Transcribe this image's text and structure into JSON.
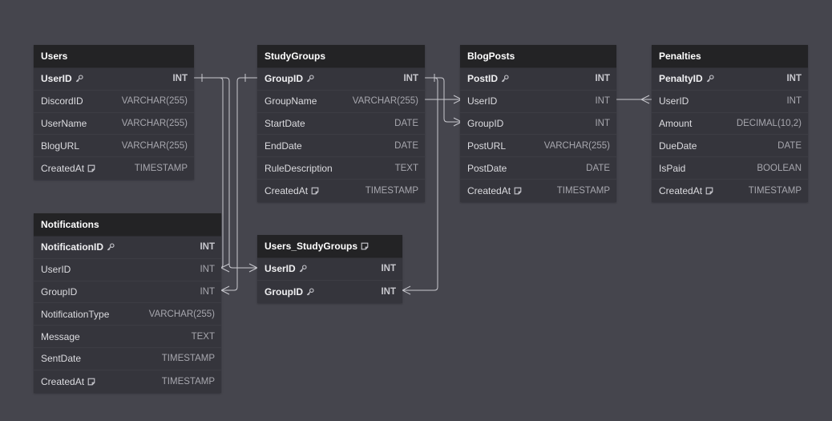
{
  "diagram": {
    "tables": [
      {
        "id": "users",
        "name": "Users",
        "note_icon": false,
        "fields": [
          {
            "name": "UserID",
            "type": "INT",
            "pk": true
          },
          {
            "name": "DiscordID",
            "type": "VARCHAR(255)"
          },
          {
            "name": "UserName",
            "type": "VARCHAR(255)"
          },
          {
            "name": "BlogURL",
            "type": "VARCHAR(255)"
          },
          {
            "name": "CreatedAt",
            "type": "TIMESTAMP",
            "note": true
          }
        ]
      },
      {
        "id": "studygroups",
        "name": "StudyGroups",
        "note_icon": false,
        "fields": [
          {
            "name": "GroupID",
            "type": "INT",
            "pk": true
          },
          {
            "name": "GroupName",
            "type": "VARCHAR(255)"
          },
          {
            "name": "StartDate",
            "type": "DATE"
          },
          {
            "name": "EndDate",
            "type": "DATE"
          },
          {
            "name": "RuleDescription",
            "type": "TEXT"
          },
          {
            "name": "CreatedAt",
            "type": "TIMESTAMP",
            "note": true
          }
        ]
      },
      {
        "id": "blogposts",
        "name": "BlogPosts",
        "note_icon": false,
        "fields": [
          {
            "name": "PostID",
            "type": "INT",
            "pk": true
          },
          {
            "name": "UserID",
            "type": "INT"
          },
          {
            "name": "GroupID",
            "type": "INT"
          },
          {
            "name": "PostURL",
            "type": "VARCHAR(255)"
          },
          {
            "name": "PostDate",
            "type": "DATE"
          },
          {
            "name": "CreatedAt",
            "type": "TIMESTAMP",
            "note": true
          }
        ]
      },
      {
        "id": "penalties",
        "name": "Penalties",
        "note_icon": false,
        "fields": [
          {
            "name": "PenaltyID",
            "type": "INT",
            "pk": true
          },
          {
            "name": "UserID",
            "type": "INT"
          },
          {
            "name": "Amount",
            "type": "DECIMAL(10,2)"
          },
          {
            "name": "DueDate",
            "type": "DATE"
          },
          {
            "name": "IsPaid",
            "type": "BOOLEAN"
          },
          {
            "name": "CreatedAt",
            "type": "TIMESTAMP",
            "note": true
          }
        ]
      },
      {
        "id": "notifications",
        "name": "Notifications",
        "note_icon": false,
        "fields": [
          {
            "name": "NotificationID",
            "type": "INT",
            "pk": true
          },
          {
            "name": "UserID",
            "type": "INT"
          },
          {
            "name": "GroupID",
            "type": "INT"
          },
          {
            "name": "NotificationType",
            "type": "VARCHAR(255)"
          },
          {
            "name": "Message",
            "type": "TEXT"
          },
          {
            "name": "SentDate",
            "type": "TIMESTAMP"
          },
          {
            "name": "CreatedAt",
            "type": "TIMESTAMP",
            "note": true
          }
        ]
      },
      {
        "id": "users_studygroups",
        "name": "Users_StudyGroups",
        "note_icon": true,
        "fields": [
          {
            "name": "UserID",
            "type": "INT",
            "pk": true
          },
          {
            "name": "GroupID",
            "type": "INT",
            "pk": true
          }
        ]
      }
    ],
    "colors": {
      "background": "#45454d",
      "header": "#232325",
      "body": "#35353c",
      "line": "#c9c9cf"
    }
  }
}
